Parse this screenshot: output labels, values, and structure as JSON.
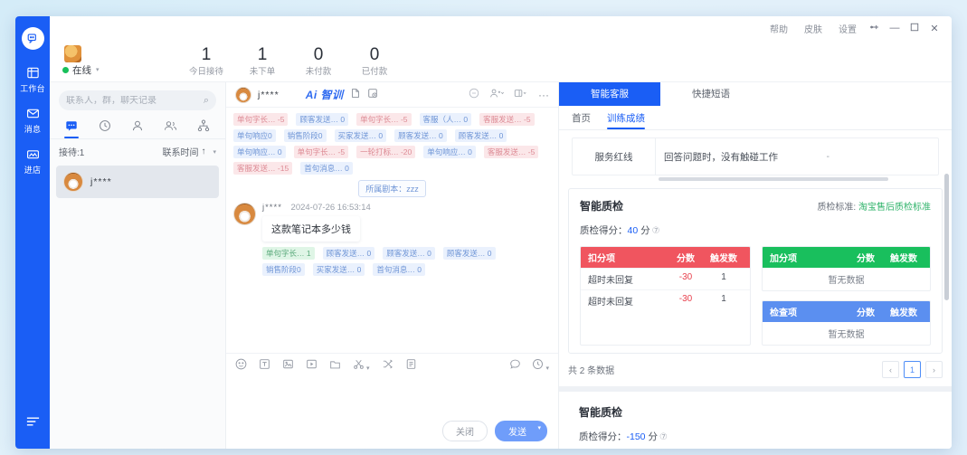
{
  "titlebar": {
    "help": "帮助",
    "skin": "皮肤",
    "settings": "设置",
    "pin": "⎗",
    "minimize": "—",
    "maximize": "▢",
    "close": "✕"
  },
  "rail": {
    "logo_icon": "chat-logo-icon",
    "items": [
      {
        "icon": "▤",
        "label": "工作台"
      },
      {
        "icon": "✉",
        "label": "消息"
      },
      {
        "icon": "▭",
        "label": "进店"
      }
    ],
    "bottom_icon": "≡"
  },
  "account": {
    "status_label": "在线",
    "caret": "▾"
  },
  "stats": [
    {
      "value": "1",
      "label": "今日接待"
    },
    {
      "value": "1",
      "label": "未下单"
    },
    {
      "value": "0",
      "label": "未付款"
    },
    {
      "value": "0",
      "label": "已付款"
    }
  ],
  "contact_list": {
    "search_placeholder": "联系人，群，聊天记录",
    "search_value": "",
    "search_icon": "⌕",
    "tabs": [
      {
        "icon": "💬",
        "name": "chat"
      },
      {
        "icon": "🕘",
        "name": "recent"
      },
      {
        "icon": "👤",
        "name": "contacts"
      },
      {
        "icon": "👥",
        "name": "groups"
      },
      {
        "icon": "⛬",
        "name": "org"
      }
    ],
    "receiving_label": "接待:1",
    "sort_label": "联系时间",
    "sort_arrow": "↑",
    "sort_caret": "▾",
    "items": [
      {
        "name": "j****"
      }
    ]
  },
  "chat": {
    "header": {
      "name": "j****",
      "ai_label": "Ai 智训",
      "icon_note": "🗋",
      "icon_history": "🗔",
      "icon_minus": "⊖",
      "icon_adduser": "👤",
      "icon_window": "▭",
      "icon_more": "···"
    },
    "top_tags": [
      [
        {
          "text": "单句字长…",
          "value": "-5",
          "color": "red"
        },
        {
          "text": "顾客发送…",
          "value": "0",
          "color": "blue"
        },
        {
          "text": "单句字长…",
          "value": "-5",
          "color": "red"
        },
        {
          "text": "客服（人…",
          "value": "0",
          "color": "blue"
        },
        {
          "text": "客服发送…",
          "value": "-5",
          "color": "red"
        }
      ],
      [
        {
          "text": "单句响应",
          "value": "0",
          "color": "blue"
        },
        {
          "text": "销售阶段",
          "value": "0",
          "color": "blue"
        },
        {
          "text": "买家发送…",
          "value": "0",
          "color": "blue"
        },
        {
          "text": "顾客发送…",
          "value": "0",
          "color": "blue"
        },
        {
          "text": "顾客发送…",
          "value": "0",
          "color": "blue"
        }
      ],
      [
        {
          "text": "单句响应…",
          "value": "0",
          "color": "blue"
        },
        {
          "text": "单句字长…",
          "value": "-5",
          "color": "red"
        },
        {
          "text": "一轮打标…",
          "value": "-20",
          "color": "red"
        },
        {
          "text": "单句响应…",
          "value": "0",
          "color": "blue"
        },
        {
          "text": "客服发送…",
          "value": "-5",
          "color": "red"
        }
      ],
      [
        {
          "text": "客服发送…",
          "value": "-15",
          "color": "red"
        },
        {
          "text": "首句消息…",
          "value": "0",
          "color": "blue"
        }
      ]
    ],
    "script_chip": "所属剧本：zzz",
    "message": {
      "sender": "j****",
      "time": "2024-07-26 16:53:14",
      "text": "这款笔记本多少钱",
      "tags": [
        [
          {
            "text": "单句字长…",
            "value": "1",
            "color": "green"
          },
          {
            "text": "顾客发送…",
            "value": "0",
            "color": "blue"
          },
          {
            "text": "顾客发送…",
            "value": "0",
            "color": "blue"
          },
          {
            "text": "顾客发送…",
            "value": "0",
            "color": "blue"
          }
        ],
        [
          {
            "text": "销售阶段",
            "value": "0",
            "color": "blue"
          },
          {
            "text": "买家发送…",
            "value": "0",
            "color": "blue"
          },
          {
            "text": "首句消息…",
            "value": "0",
            "color": "blue"
          }
        ]
      ]
    },
    "composer": {
      "tools": [
        "☺",
        "T",
        "🖼",
        "▶",
        "🗂",
        "✂",
        "✄",
        "🗒"
      ],
      "right_tools": [
        "🗩",
        "🕘"
      ],
      "input_value": "",
      "close_label": "关闭",
      "send_label": "发送",
      "send_caret": "▾"
    }
  },
  "right_panel": {
    "tabs": [
      {
        "label": "智能客服",
        "active": true
      },
      {
        "label": "快捷短语",
        "active": false
      }
    ],
    "subtabs": [
      {
        "label": "首页",
        "active": false
      },
      {
        "label": "训练成绩",
        "active": true
      }
    ],
    "redline": {
      "key": "服务红线",
      "value": "回答问题时，没有触碰工作",
      "dash": "-"
    },
    "qc_sections": [
      {
        "title": "智能质检",
        "standard_label": "质检标准:",
        "standard_value": "淘宝售后质检标准",
        "score_label": "质检得分：",
        "score_value": "40",
        "score_unit": "分",
        "deduct_table": {
          "header": [
            "扣分项",
            "分数",
            "触发数"
          ],
          "rows": [
            {
              "name": "超时未回复",
              "score": "-30",
              "count": "1"
            },
            {
              "name": "超时未回复",
              "score": "-30",
              "count": "1"
            }
          ]
        },
        "add_table": {
          "header": [
            "加分项",
            "分数",
            "触发数"
          ],
          "empty": "暂无数据"
        },
        "check_table": {
          "header": [
            "检查项",
            "分数",
            "触发数"
          ],
          "empty": "暂无数据"
        },
        "pager": {
          "count_text": "共 2 条数据",
          "prev": "‹",
          "page": "1",
          "next": "›"
        }
      },
      {
        "title": "智能质检",
        "score_label": "质检得分：",
        "score_value": "-150",
        "score_unit": "分"
      }
    ]
  }
}
